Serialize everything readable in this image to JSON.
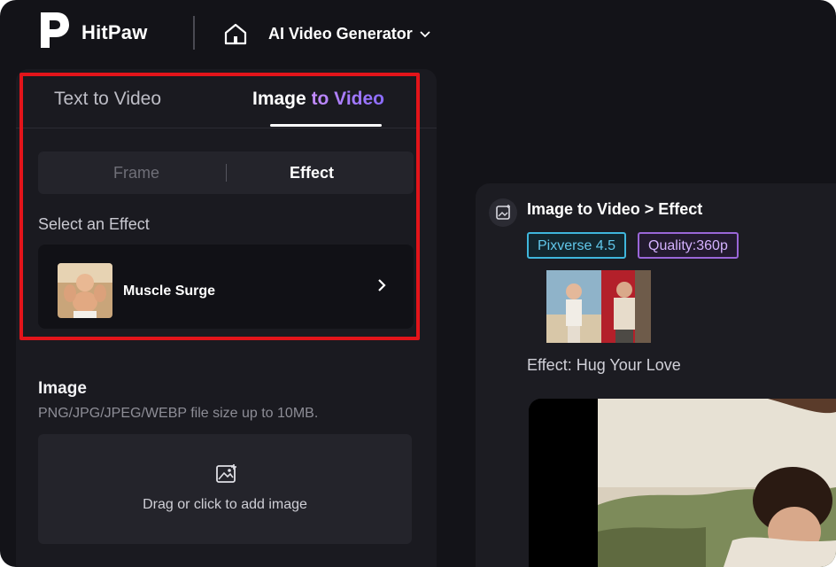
{
  "brand": {
    "name": "HitPaw"
  },
  "header": {
    "app_selector": "AI Video Generator"
  },
  "tabs": [
    {
      "label": "Text to Video",
      "active": false
    },
    {
      "label_part1": "Image ",
      "label_part2": "to Video",
      "active": true
    }
  ],
  "mode": {
    "frame_label": "Frame",
    "effect_label": "Effect",
    "active": "Effect"
  },
  "effect_select": {
    "label": "Select an Effect",
    "selected": "Muscle Surge"
  },
  "image_upload": {
    "title": "Image",
    "hint": "PNG/JPG/JPEG/WEBP file size up to 10MB.",
    "dropzone_text": "Drag or click to add image"
  },
  "task": {
    "title": "Image to Video > Effect",
    "model": "Pixverse 4.5",
    "quality": "Quality:360p",
    "effect": "Effect: Hug Your Love"
  },
  "colors": {
    "accent": "#e3141a",
    "gradient_start": "#c48cff",
    "gradient_end": "#8a6bff",
    "model_badge": "#3fb6dc",
    "quality_badge": "#9a66d8"
  }
}
